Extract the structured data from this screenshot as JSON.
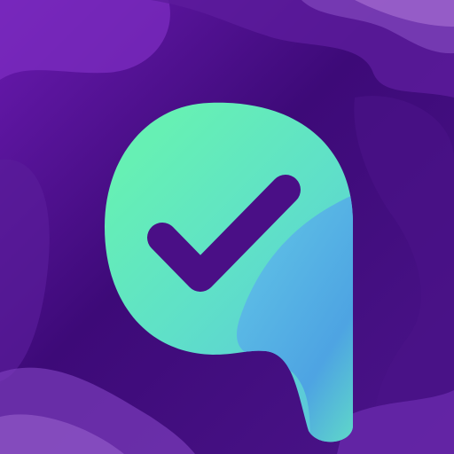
{
  "app_icon": {
    "logo_name": "check-speech-bubble-logo",
    "mark_icon": "checkmark-icon",
    "colors": {
      "background_dark": "#35096b",
      "background_mid": "#5a1a9a",
      "background_light": "#8a3fc4",
      "bubble_mint": "#63ecb6",
      "bubble_teal": "#5fd6cf",
      "bubble_blue": "#4aa8e6",
      "check_purple": "#4a0f86"
    }
  }
}
